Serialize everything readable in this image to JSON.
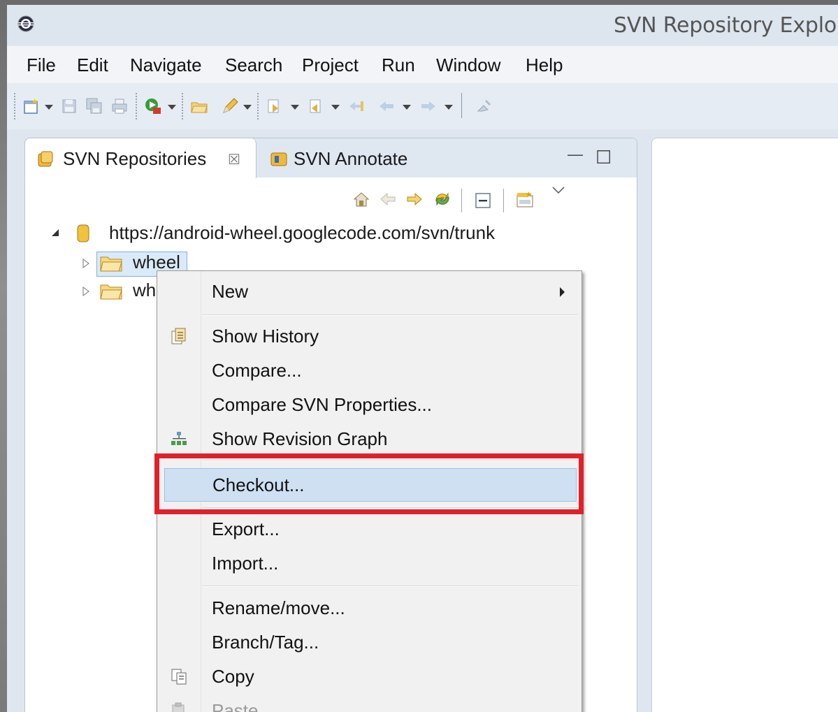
{
  "window": {
    "title": "SVN Repository Explo"
  },
  "menubar": {
    "items": [
      "File",
      "Edit",
      "Navigate",
      "Search",
      "Project",
      "Run",
      "Window",
      "Help"
    ]
  },
  "toolbar": {
    "icons": [
      "new-wizard-icon",
      "save-icon",
      "save-all-icon",
      "print-icon",
      "debug-run-icon",
      "open-task-icon",
      "pen-icon",
      "next-annotation-icon",
      "prev-annotation-icon",
      "last-edit-icon",
      "back-icon",
      "forward-icon",
      "pin-icon"
    ]
  },
  "view": {
    "tab_active": "SVN Repositories",
    "tab_close": "☒",
    "tab_inactive": "SVN Annotate",
    "minimize": "—",
    "maximize": "☐"
  },
  "tree": {
    "root": "https://android-wheel.googlecode.com/svn/trunk",
    "children": [
      {
        "label": "wheel",
        "selected": true
      },
      {
        "label": "wh",
        "selected": false
      }
    ]
  },
  "context_menu": {
    "items": [
      {
        "label": "New",
        "submenu": true
      },
      {
        "label": "Show History",
        "icon": "history-icon"
      },
      {
        "label": "Compare..."
      },
      {
        "label": "Compare SVN Properties..."
      },
      {
        "label": "Show Revision Graph",
        "icon": "revision-graph-icon"
      },
      {
        "label": "Checkout...",
        "highlighted": true
      },
      {
        "label": "Export..."
      },
      {
        "label": "Import..."
      },
      {
        "label": "Rename/move..."
      },
      {
        "label": "Branch/Tag..."
      },
      {
        "label": "Copy",
        "icon": "copy-icon"
      },
      {
        "label": "Paste",
        "icon": "paste-icon",
        "disabled": true
      }
    ]
  },
  "colors": {
    "highlight": "#cfe0f3",
    "annotation_box": "#e0202a"
  }
}
